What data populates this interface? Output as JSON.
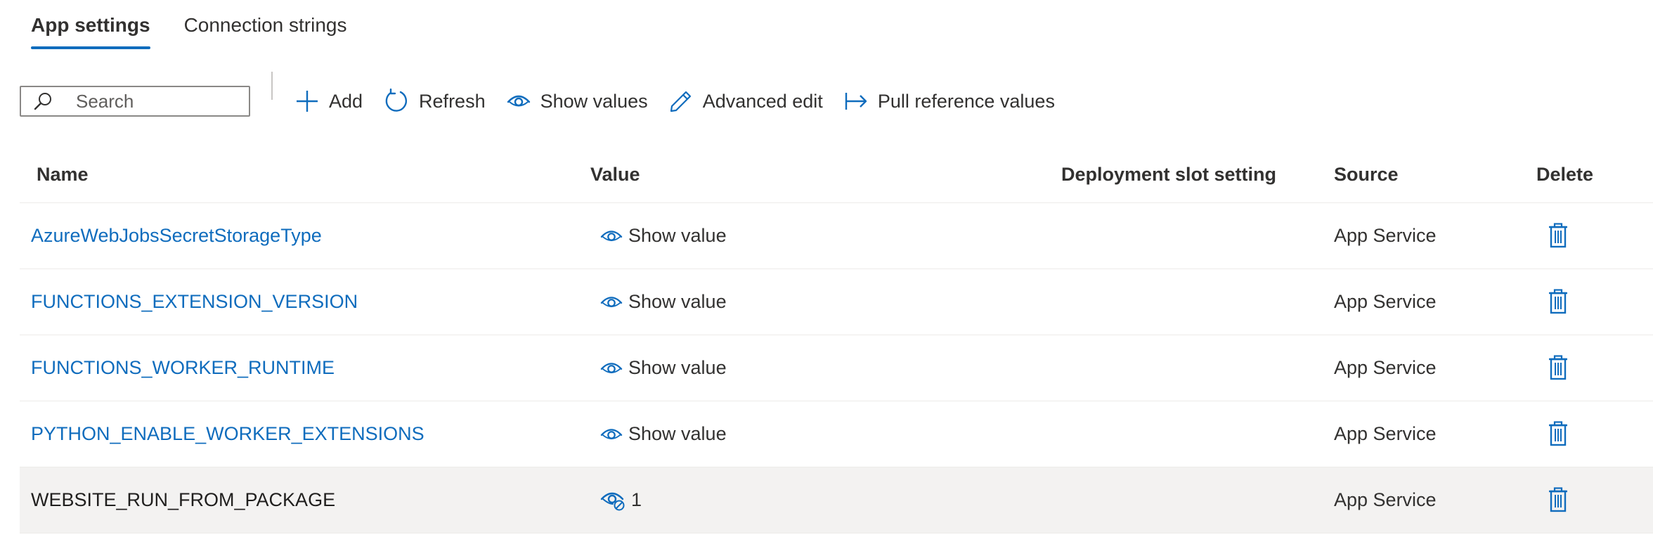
{
  "tabs": [
    {
      "label": "App settings",
      "active": true
    },
    {
      "label": "Connection strings",
      "active": false
    }
  ],
  "toolbar": {
    "search_placeholder": "Search",
    "add_label": "Add",
    "refresh_label": "Refresh",
    "show_values_label": "Show values",
    "advanced_edit_label": "Advanced edit",
    "pull_reference_label": "Pull reference values"
  },
  "table": {
    "headers": {
      "name": "Name",
      "value": "Value",
      "slot": "Deployment slot setting",
      "source": "Source",
      "delete": "Delete"
    },
    "rows": [
      {
        "name": "AzureWebJobsSecretStorageType",
        "value": "Show value",
        "hidden": true,
        "source": "App Service"
      },
      {
        "name": "FUNCTIONS_EXTENSION_VERSION",
        "value": "Show value",
        "hidden": true,
        "source": "App Service"
      },
      {
        "name": "FUNCTIONS_WORKER_RUNTIME",
        "value": "Show value",
        "hidden": true,
        "source": "App Service"
      },
      {
        "name": "PYTHON_ENABLE_WORKER_EXTENSIONS",
        "value": "Show value",
        "hidden": true,
        "source": "App Service"
      },
      {
        "name": "WEBSITE_RUN_FROM_PACKAGE",
        "value": "1",
        "hidden": false,
        "source": "App Service"
      }
    ]
  },
  "colors": {
    "accent": "#0f6cbd",
    "text": "#323130",
    "selected_row": "#f3f2f1"
  },
  "icons": {
    "search": "search-icon",
    "add": "plus-icon",
    "refresh": "refresh-icon",
    "show": "eye-icon",
    "edit": "pencil-icon",
    "pull": "arrow-right-bar-icon",
    "hide": "eye-hide-icon",
    "delete": "trash-icon"
  }
}
